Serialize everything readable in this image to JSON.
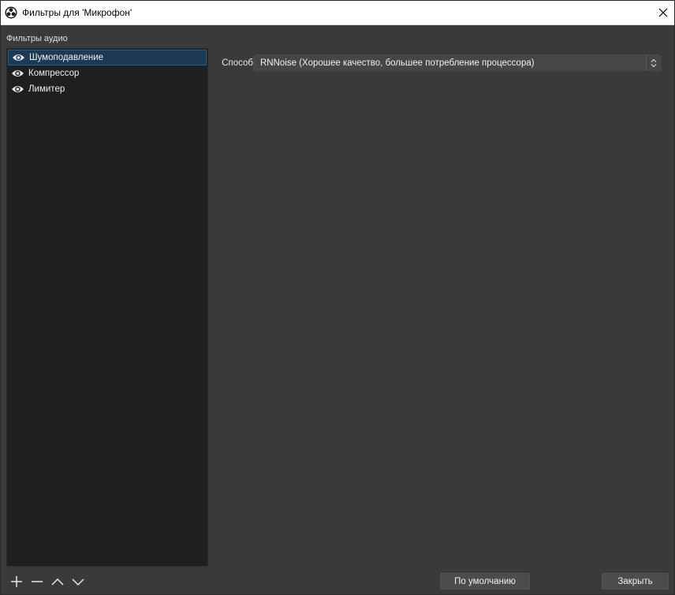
{
  "window": {
    "title": "Фильтры для 'Микрофон'",
    "app_icon": "obs-logo-icon",
    "close_icon": "close-icon"
  },
  "audio_filters": {
    "label": "Фильтры аудио",
    "items": [
      {
        "label": "Шумоподавление",
        "visible": true,
        "selected": true
      },
      {
        "label": "Компрессор",
        "visible": true,
        "selected": false
      },
      {
        "label": "Лимитер",
        "visible": true,
        "selected": false
      }
    ]
  },
  "properties": {
    "method_label": "Способ",
    "method_value": "RNNoise (Хорошее качество, большее потребление процессора)"
  },
  "toolbar": {
    "add_icon": "plus-icon",
    "remove_icon": "minus-icon",
    "move_up_icon": "chevron-up-icon",
    "move_down_icon": "chevron-down-icon"
  },
  "buttons": {
    "defaults_label": "По умолчанию",
    "close_label": "Закрыть"
  },
  "colors": {
    "background": "#3a3a3a",
    "list_background": "#1f1f1f",
    "selection": "#1c3a55",
    "titlebar": "#ffffff"
  }
}
